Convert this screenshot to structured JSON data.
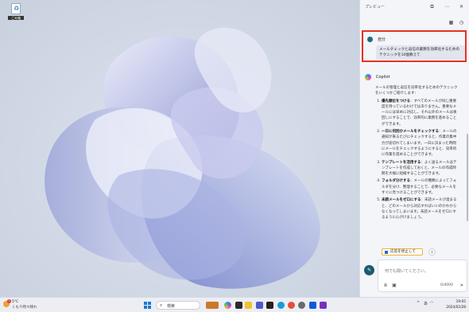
{
  "desktop": {
    "recycle_bin_label": "ごみ箱"
  },
  "copilot": {
    "window_title": "プレビュー",
    "user": {
      "name": "自分",
      "message": "メールチェックと返信の業務を効率化するためのテクニックを10個教えて"
    },
    "assistant": {
      "name": "Copilot",
      "intro": "メールの管理と返信を効率化するためのテクニックをいくつかご紹介します：",
      "items": [
        {
          "title": "優先順位をつける",
          "body": "すべてのメールが同じ重要度を持っているわけではありません。重要なメールには早めに対応し、それ以外のメールは後回しにすることで、効率的に業務を進めることができます。"
        },
        {
          "title": "一日に何回かメールをチェックする",
          "body": "メールの通知が来るたびにチェックすると、作業の集中力が途切れてしまいます。一日に決まった時間にメールをチェックするようにすると、効率的に作業を進めることができます。"
        },
        {
          "title": "テンプレートを活用する",
          "body": "よく送るメールはテンプレートを作成しておくと、メールの作成時間を大幅に短縮することができます。"
        },
        {
          "title": "フォルダ分けする",
          "body": "メールの種類によってフォルダを分け、整理することで、必要なメールをすぐに見つけることができます。"
        },
        {
          "title": "未読メールをゼロにする",
          "body": "未読メールが溜まると、どのメールから対応すればいいのかわからなくなってしまいます。未読メールをゼロにするように心がけましょう。"
        }
      ],
      "stop_button": "応答を停止して"
    },
    "input": {
      "placeholder": "何でも聞いてください。",
      "counter": "0/4000"
    },
    "colors": {
      "highlight_border": "#e53225",
      "stop_border": "#f2b133",
      "accent": "#1a6fcf"
    }
  },
  "taskbar": {
    "weather": {
      "temp": "5°C",
      "condition": "くもり時々晴れ",
      "badge": "1"
    },
    "search_label": "検索",
    "tray": {
      "chevron": "^",
      "lang": "あ"
    },
    "clock": {
      "time": "19:05",
      "date": "2024/02/28"
    }
  }
}
